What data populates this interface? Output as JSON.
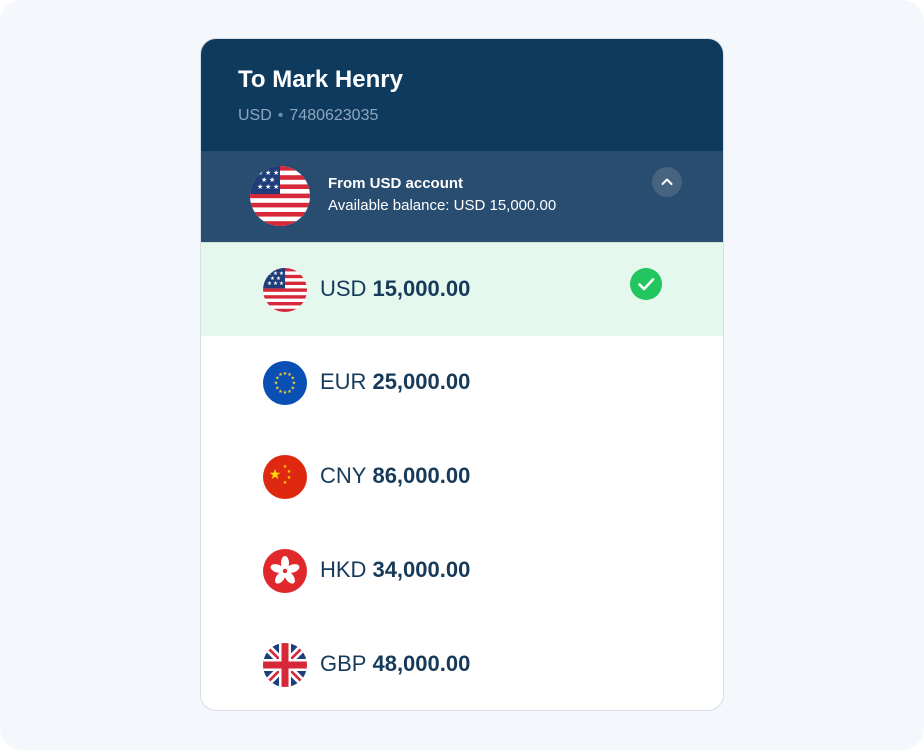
{
  "recipient": {
    "name": "To Mark Henry",
    "currency": "USD",
    "account_number": "7480623035"
  },
  "from_account": {
    "title": "From USD account",
    "balance": "Available balance: USD 15,000.00",
    "flag": "us-flag-icon"
  },
  "accounts": [
    {
      "code": "USD",
      "amount": "15,000.00",
      "flag": "us-flag-icon",
      "selected": true
    },
    {
      "code": "EUR",
      "amount": "25,000.00",
      "flag": "eu-flag-icon",
      "selected": false
    },
    {
      "code": "CNY",
      "amount": "86,000.00",
      "flag": "cn-flag-icon",
      "selected": false
    },
    {
      "code": "HKD",
      "amount": "34,000.00",
      "flag": "hk-flag-icon",
      "selected": false
    },
    {
      "code": "GBP",
      "amount": "48,000.00",
      "flag": "gb-flag-icon",
      "selected": false
    }
  ],
  "colors": {
    "header_bg": "#0e3a5e",
    "from_panel_bg": "#284d71",
    "selected_bg": "#e5f8ee",
    "check_green": "#22c55e",
    "text_dark": "#163a5a"
  }
}
